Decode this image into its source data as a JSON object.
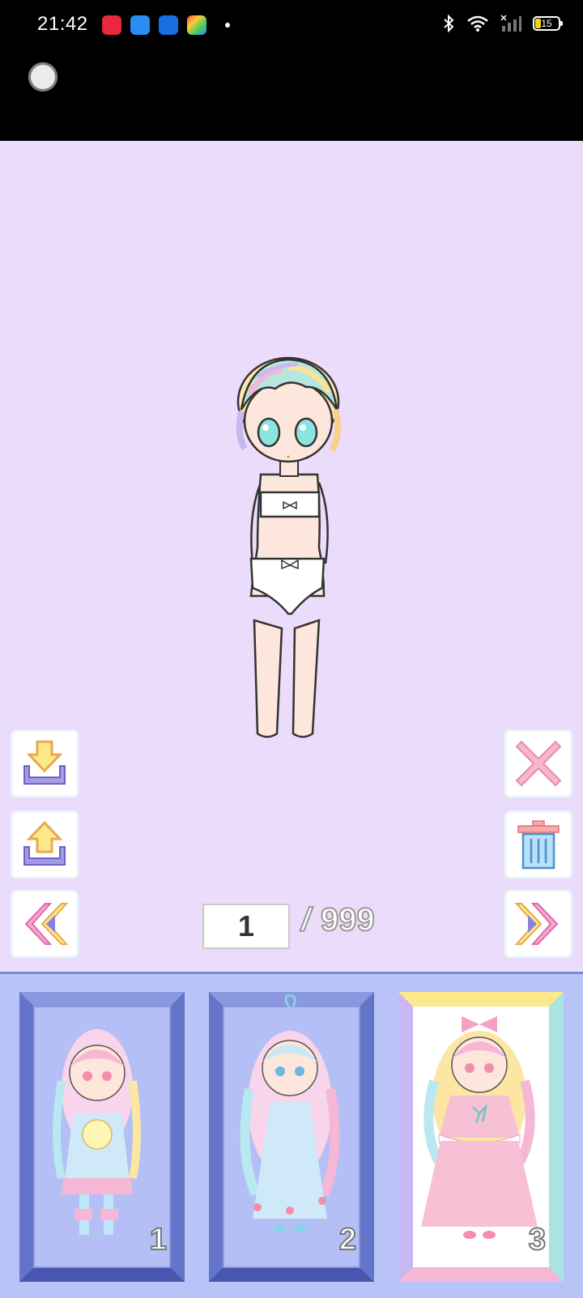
{
  "status": {
    "time": "21:42",
    "battery": "15"
  },
  "pager": {
    "current": "1",
    "separator": "/",
    "total": "999"
  },
  "slots": [
    {
      "label": "1",
      "selected": false
    },
    {
      "label": "2",
      "selected": false
    },
    {
      "label": "3",
      "selected": true
    }
  ],
  "colors": {
    "stage_bg": "#eadcfa",
    "tray_bg": "#b8c4f7",
    "frame_blue": "#6474c8"
  },
  "icons": [
    "download-icon",
    "upload-icon",
    "previous-icon",
    "close-icon",
    "trash-icon",
    "next-icon"
  ]
}
